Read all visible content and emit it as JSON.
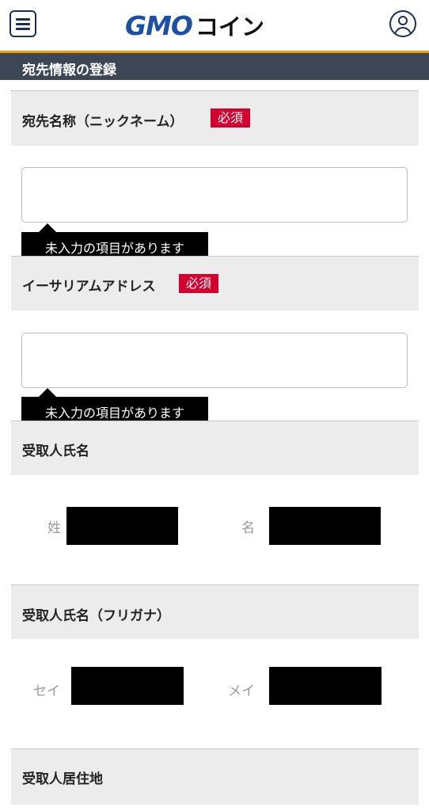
{
  "header": {
    "logo_gmo": "GMO",
    "logo_coin": "コイン",
    "menu_icon": "hamburger-menu-icon",
    "account_icon": "user-account-icon",
    "accent_color": "#f39800",
    "brand_color": "#1b4fa8"
  },
  "section": {
    "title": "宛先情報の登録"
  },
  "fields": {
    "nickname": {
      "label": "宛先名称（ニックネーム）",
      "required": "必須",
      "value": "",
      "error": "未入力の項目があります"
    },
    "eth_address": {
      "label": "イーサリアムアドレス",
      "required": "必須",
      "value": "",
      "error": "未入力の項目があります"
    },
    "recipient_name": {
      "label": "受取人氏名",
      "last_name_label": "姓",
      "first_name_label": "名"
    },
    "recipient_kana": {
      "label": "受取人氏名（フリガナ）",
      "last_name_label": "セイ",
      "first_name_label": "メイ"
    },
    "recipient_address": {
      "label": "受取人居住地"
    }
  },
  "colors": {
    "required_badge": "#d3002f",
    "section_bar": "#3c4654",
    "redaction": "#000000"
  }
}
